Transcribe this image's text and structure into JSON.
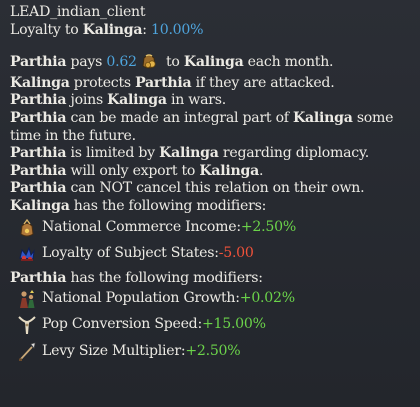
{
  "header": {
    "ai_tag": "LEAD_indian_client",
    "loyalty_prefix": "Loyalty to ",
    "overlord": "Kalinga",
    "loyalty_sep": ": ",
    "loyalty_value": "10.00%"
  },
  "payment": {
    "subject": "Parthia",
    "pays_text": " pays ",
    "amount": "0.62",
    "to_text": " to ",
    "overlord": "Kalinga",
    "each_month": " each month.",
    "icon": "gold-coins-icon"
  },
  "terms": [
    {
      "a": "Kalinga",
      "t1": " protects ",
      "b": "Parthia",
      "t2": " if they are attacked."
    },
    {
      "a": "Parthia",
      "t1": " joins ",
      "b": "Kalinga",
      "t2": " in wars."
    },
    {
      "a": "Parthia",
      "t1": " can be made an integral part of ",
      "b": "Kalinga",
      "t2": " some time in the future."
    },
    {
      "a": "Parthia",
      "t1": " is limited by ",
      "b": "Kalinga",
      "t2": " regarding diplomacy."
    },
    {
      "a": "Parthia",
      "t1": " will only export to ",
      "b": "Kalinga",
      "t2": "."
    },
    {
      "a": "Parthia",
      "t1": " can NOT cancel this relation on their own.",
      "b": "",
      "t2": ""
    }
  ],
  "overlord_modifiers": {
    "owner": "Kalinga",
    "heading": " has the following modifiers:",
    "items": [
      {
        "icon": "commerce-pouch-icon",
        "label": "National Commerce Income: ",
        "value": "+2.50%",
        "tone": "green"
      },
      {
        "icon": "loyalty-crown-icon",
        "label": "Loyalty of Subject States: ",
        "value": "-5.00",
        "tone": "red"
      }
    ]
  },
  "subject_modifiers": {
    "owner": "Parthia",
    "heading": " has the following modifiers:",
    "items": [
      {
        "icon": "population-growth-icon",
        "label": "National Population Growth: ",
        "value": "+0.02%",
        "tone": "green"
      },
      {
        "icon": "pop-conversion-icon",
        "label": "Pop Conversion Speed: ",
        "value": "+15.00%",
        "tone": "green"
      },
      {
        "icon": "levy-spear-icon",
        "label": "Levy Size Multiplier: ",
        "value": "+2.50%",
        "tone": "green"
      }
    ]
  },
  "colors": {
    "background": "#262930",
    "text": "#eceae4",
    "highlight_blue": "#4ea4dc",
    "positive": "#6bd34a",
    "negative": "#f0523a"
  }
}
